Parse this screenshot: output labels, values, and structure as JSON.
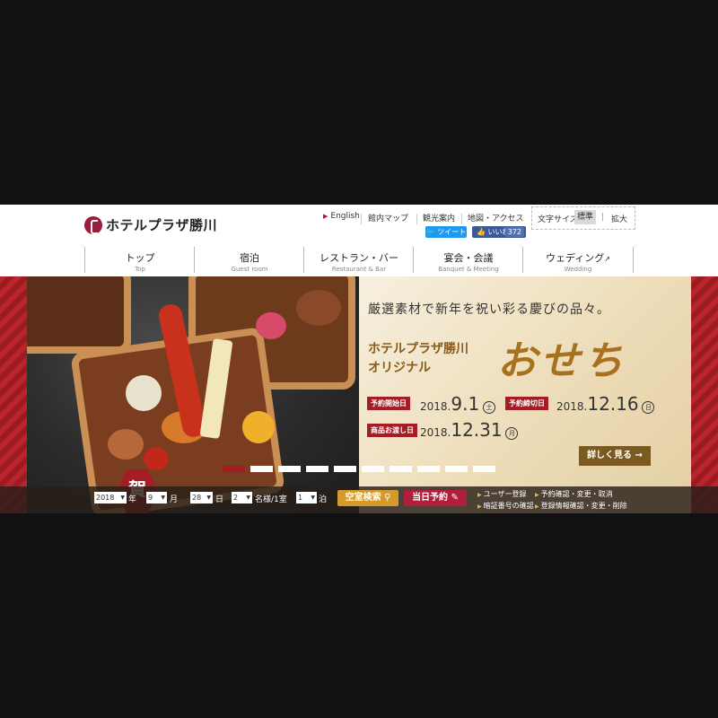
{
  "header": {
    "logo_text": "ホテルプラザ勝川",
    "util_links": [
      "English",
      "館内マップ",
      "観光案内",
      "地図・アクセス"
    ],
    "font_size": {
      "label": "文字サイズ",
      "standard": "標準",
      "large": "拡大"
    },
    "tweet": "ツイート",
    "like": {
      "label": "いいね！",
      "count": "372"
    }
  },
  "nav": [
    {
      "jp": "トップ",
      "en": "Top"
    },
    {
      "jp": "宿泊",
      "en": "Guest room"
    },
    {
      "jp": "レストラン・バー",
      "en": "Restaurant & Bar"
    },
    {
      "jp": "宴会・会議",
      "en": "Banquet & Meeting"
    },
    {
      "jp": "ウェディング",
      "en": "Wedding",
      "ext_icon": "external-link-icon"
    }
  ],
  "hero": {
    "tagline": "厳選素材で新年を祝い彩る慶びの品々。",
    "subtitle_line1": "ホテルプラザ勝川",
    "subtitle_line2": "オリジナル",
    "title": "おせち",
    "stamp": "賀",
    "order_start": {
      "label": "予約開始日",
      "date": "2018.",
      "big": "9.1",
      "day": "土"
    },
    "order_end": {
      "label": "予約締切日",
      "date": "2018.",
      "big": "12.16",
      "day": "日"
    },
    "delivery": {
      "label": "商品お渡し日",
      "date": "2018.",
      "big": "12.31",
      "day": "月"
    },
    "more_button": "詳しく見る →",
    "slide_count": 10,
    "active_slide": 1
  },
  "booking": {
    "year": "2018",
    "year_label": "年",
    "month": "9",
    "month_label": "月",
    "day": "28",
    "day_label": "日",
    "guests": "2",
    "guests_label": "名様/1室",
    "nights": "1",
    "nights_label": "泊",
    "search_button": "空室検索",
    "today_button": "当日予約",
    "links": [
      "ユーザー登録",
      "予約確認・変更・取消",
      "暗証番号の確認",
      "登録情報確認・変更・削除"
    ]
  },
  "colors": {
    "brand": "#9b1c3b",
    "hero_red": "#a51d24",
    "gold": "#a8711e"
  }
}
